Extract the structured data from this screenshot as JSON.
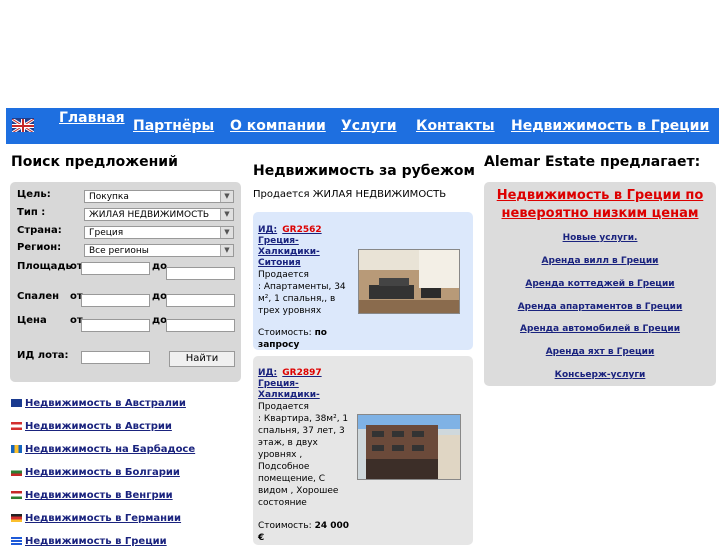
{
  "nav": {
    "items": [
      {
        "label": "Главная"
      },
      {
        "label": "Партнёры"
      },
      {
        "label": "О компании"
      },
      {
        "label": "Услуги"
      },
      {
        "label": "Контакты"
      },
      {
        "label": "Недвижимость в Греции"
      }
    ]
  },
  "search": {
    "title": "Поиск предложений",
    "labels": {
      "goal": "Цель:",
      "type": "Тип :",
      "country": "Страна:",
      "region": "Регион:",
      "area": "Площадь",
      "bedrooms": "Спален",
      "price": "Цена",
      "lot_id": "ИД лота:",
      "from": "от",
      "to": "до"
    },
    "values": {
      "goal": "Покупка",
      "type": "ЖИЛАЯ НЕДВИЖИМОСТЬ",
      "country": "Греция",
      "region": "Все регионы"
    },
    "button": "Найти"
  },
  "countries": [
    {
      "label": "Недвижимость в Австралии",
      "flag": "#1a3a8f"
    },
    {
      "label": "Недвижимость в Австрии",
      "flag": "#d32f2f"
    },
    {
      "label": "Недвижимость на Барбадосе",
      "flag": "#1565c0"
    },
    {
      "label": "Недвижимость в Болгарии",
      "flag": "#2e7d32"
    },
    {
      "label": "Недвижимость в Венгрии",
      "flag": "#c62828"
    },
    {
      "label": "Недвижимость в Германии",
      "flag": "#222222"
    },
    {
      "label": "Недвижимость в Греции",
      "flag": "#1e5ad8"
    }
  ],
  "middle": {
    "title": "Недвижимость за рубежом",
    "subtitle_prefix": "Продается ",
    "subtitle_main": "ЖИЛАЯ НЕДВИЖИМОСТЬ",
    "cards": [
      {
        "id_label": "ИД:",
        "id_code": "GR2562",
        "title": "Греция-Халкидики-Ситония",
        "desc1": "Продается",
        "desc2": ": Апартаменты, 34 м², 1 спальня,, в трех уровнях",
        "price_label": "Стоимость:",
        "price": "по запросу"
      },
      {
        "id_label": "ИД:",
        "id_code": "GR2897",
        "title": "Греция-Халкидики-",
        "desc1": "Продается",
        "desc2": ": Квартира, 38м², 1 спальня, 37 лет, 3 этаж, в двух уровнях , Подсобное помещение, С видом , Хорошее состояние",
        "price_label": "Стоимость:",
        "price": "24 000 €"
      }
    ]
  },
  "right": {
    "title": "Alemar Estate предлагает:",
    "headline": "Недвижимость в Греции по невероятно низким ценам",
    "offers": [
      "Новые услуги.",
      "Аренда вилл в Греции",
      "Аренда коттеджей в Греции",
      "Аренда апартаментов в Греции",
      "Аренда автомобилей в Греции",
      "Аренда яхт в Греции",
      "Консьерж-услуги"
    ]
  }
}
